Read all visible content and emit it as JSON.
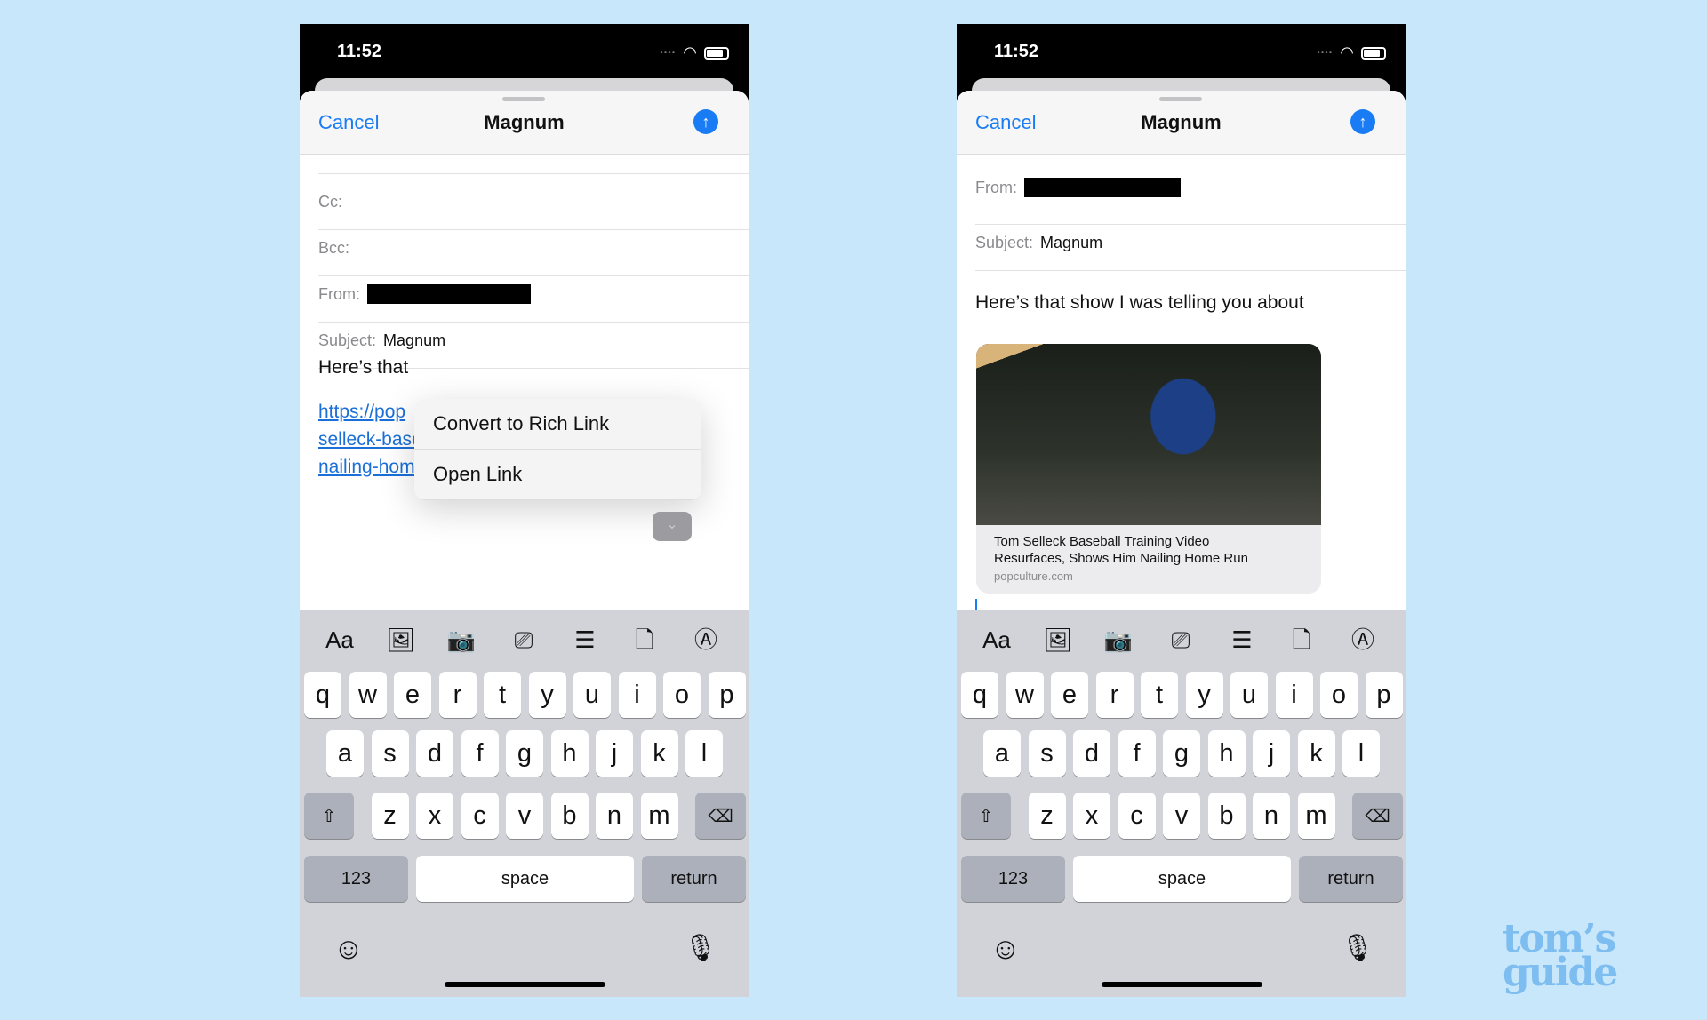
{
  "background": "#c9e7fb",
  "accent": "#1a7cf5",
  "phones": [
    {
      "status_time": "11:52",
      "header": {
        "cancel": "Cancel",
        "title": "Magnum",
        "send_icon": "arrow-up-circle"
      },
      "fields": [
        {
          "label": "Cc:",
          "value": ""
        },
        {
          "label": "Bcc:",
          "value": ""
        },
        {
          "label": "From:",
          "value": "[redacted]"
        },
        {
          "label": "Subject:",
          "value": "Magnum"
        }
      ],
      "body": "Here’s that",
      "link_lines": [
        "https://pop",
        "selleck-baseball-training-video-resurfaces-",
        "nailing-home-run/"
      ],
      "context_menu": [
        "Convert to Rich Link",
        "Open Link"
      ]
    },
    {
      "status_time": "11:52",
      "header": {
        "cancel": "Cancel",
        "title": "Magnum",
        "send_icon": "arrow-up-circle"
      },
      "fields": [
        {
          "label": "From:",
          "value": "[redacted]"
        },
        {
          "label": "Subject:",
          "value": "Magnum"
        }
      ],
      "body": "Here’s that show I was telling you about",
      "rich_link": {
        "title_lines": [
          "Tom Selleck Baseball Training Video",
          "Resurfaces, Shows Him Nailing Home Run"
        ],
        "site": "popculture.com"
      }
    }
  ],
  "toolbar": {
    "text_format": "Aa",
    "icons": [
      "photo-library",
      "camera",
      "scan-document",
      "scan-text",
      "file",
      "markup"
    ]
  },
  "keyboard": {
    "rows": [
      [
        "q",
        "w",
        "e",
        "r",
        "t",
        "y",
        "u",
        "i",
        "o",
        "p"
      ],
      [
        "a",
        "s",
        "d",
        "f",
        "g",
        "h",
        "j",
        "k",
        "l"
      ],
      [
        "z",
        "x",
        "c",
        "v",
        "b",
        "n",
        "m"
      ]
    ],
    "numbers": "123",
    "space": "space",
    "return": "return",
    "shift_icon": "shift",
    "delete_icon": "delete",
    "emoji_icon": "emoji",
    "mic_icon": "microphone"
  },
  "watermark": "tom’s guide"
}
